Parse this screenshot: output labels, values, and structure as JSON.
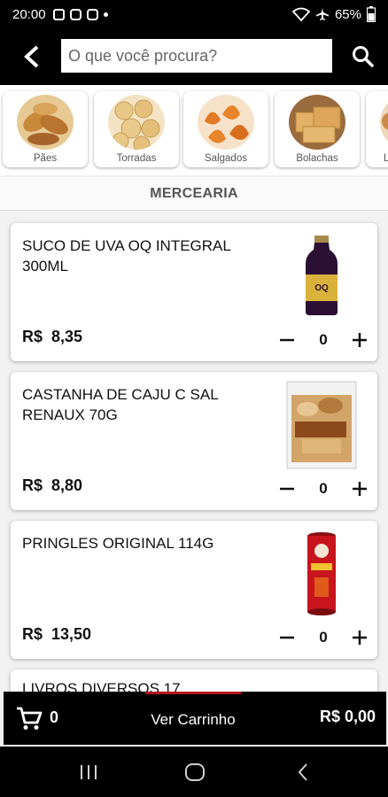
{
  "status_bar": {
    "time": "20:00",
    "battery": "65%",
    "icons": [
      "gallery-icon",
      "instagram-icon",
      "instagram-icon",
      "dot-icon",
      "wifi-icon",
      "airplane-icon",
      "battery-icon"
    ]
  },
  "header": {
    "back_icon": "chevron-left-icon",
    "search_placeholder": "O que você procura?",
    "search_icon": "search-icon"
  },
  "categories": [
    {
      "label": "Pães"
    },
    {
      "label": "Torradas"
    },
    {
      "label": "Salgados"
    },
    {
      "label": "Bolachas"
    },
    {
      "label": "L"
    }
  ],
  "section": {
    "title": "MERCEARIA"
  },
  "products": [
    {
      "name": "SUCO DE UVA OQ INTEGRAL 300ML",
      "currency": "R$",
      "price": "8,35",
      "quantity": "0"
    },
    {
      "name": "CASTANHA DE CAJU C SAL RENAUX 70G",
      "currency": "R$",
      "price": "8,80",
      "quantity": "0"
    },
    {
      "name": "PRINGLES ORIGINAL 114G",
      "currency": "R$",
      "price": "13,50",
      "quantity": "0"
    },
    {
      "name": "LIVROS DIVERSOS 17"
    }
  ],
  "cart_bar": {
    "count": "0",
    "view_cart_label": "Ver Carrinho",
    "total": "R$ 0,00"
  },
  "colors": {
    "header_bg": "#000000",
    "accent": "#b3141c",
    "background": "#f1f1f1"
  }
}
